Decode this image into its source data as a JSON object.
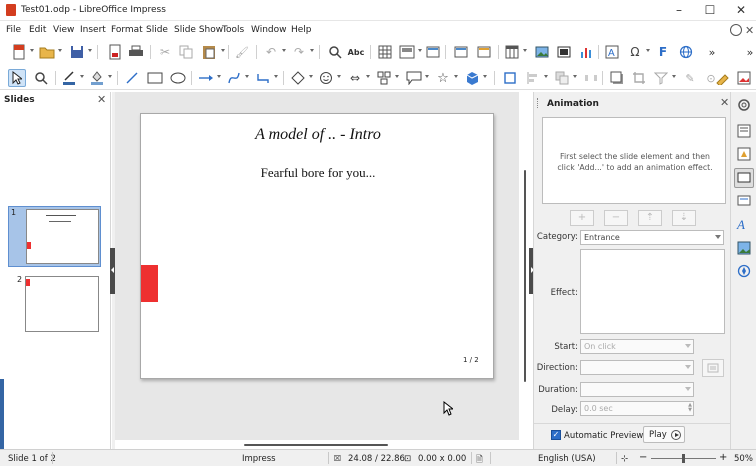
{
  "window": {
    "title": "Test01.odp - LibreOffice Impress",
    "minimize": "–",
    "maximize": "☐",
    "close": "✕"
  },
  "menu": [
    "File",
    "Edit",
    "View",
    "Insert",
    "Format",
    "Slide",
    "Slide Show",
    "Tools",
    "Window",
    "Help"
  ],
  "slides_panel": {
    "title": "Slides",
    "close": "✕",
    "items": [
      {
        "number": "1"
      },
      {
        "number": "2"
      }
    ]
  },
  "slide": {
    "title": "A model of .. - Intro",
    "subtitle": "Fearful bore for you...",
    "page_number": "1 / 2",
    "accent_color": "#ee3030"
  },
  "animation_panel": {
    "title": "Animation",
    "close": "✕",
    "hint": "First select the slide element and then click 'Add...' to add an animation effect.",
    "buttons": [
      "+",
      "−",
      "⇡",
      "⇣"
    ],
    "category_label": "Category:",
    "category_value": "Entrance",
    "effect_label": "Effect:",
    "start_label": "Start:",
    "start_value": "On click",
    "direction_label": "Direction:",
    "direction_value": "",
    "duration_label": "Duration:",
    "duration_value": "",
    "delay_label": "Delay:",
    "delay_value": "0.0 sec",
    "auto_preview_label": "Automatic Preview",
    "auto_preview_checked": true,
    "play_label": "Play"
  },
  "statusbar": {
    "slide_info": "Slide 1 of 2",
    "master": "Impress",
    "position": "24.08 / 22.86",
    "size": "0.00 x 0.00",
    "language": "English (USA)",
    "zoom_minus": "−",
    "zoom_plus": "+",
    "zoom": "50%"
  }
}
